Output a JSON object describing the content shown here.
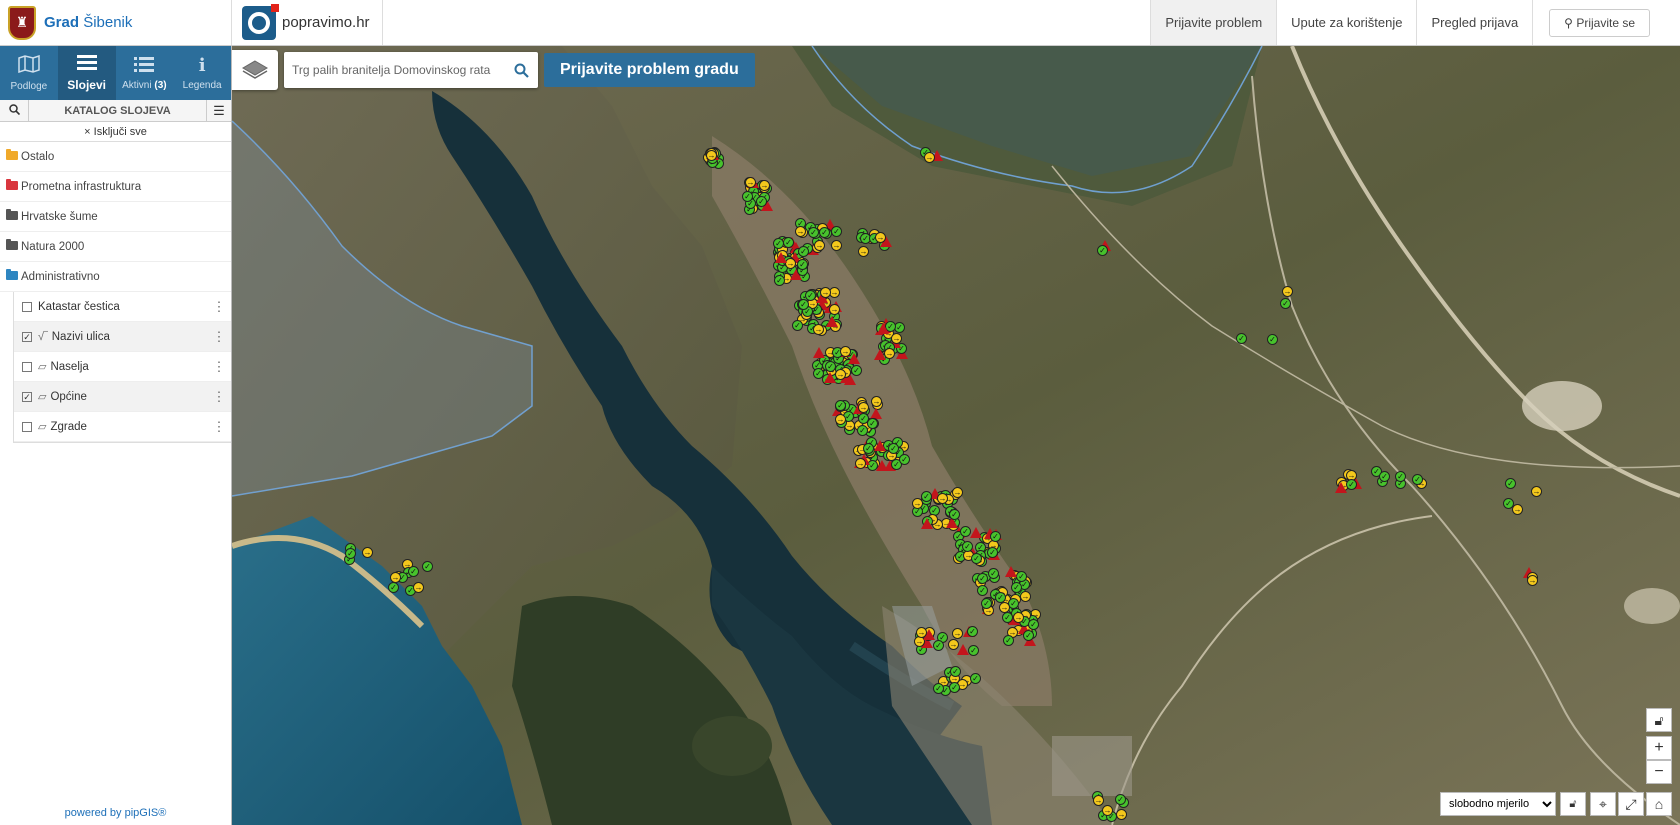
{
  "header": {
    "brand_bold": "Grad",
    "brand_rest": "Šibenik",
    "app_name": "popravimo.hr",
    "nav": [
      {
        "label": "Prijavite problem",
        "active": true
      },
      {
        "label": "Upute za korištenje",
        "active": false
      },
      {
        "label": "Pregled prijava",
        "active": false
      }
    ],
    "login_label": "Prijavite se"
  },
  "sidebar": {
    "tabs": [
      {
        "label": "Podloge",
        "icon": "map-icon"
      },
      {
        "label": "Slojevi",
        "icon": "layers-list-icon",
        "active": true
      },
      {
        "label": "Aktivni",
        "count": "(3)",
        "icon": "list-icon"
      },
      {
        "label": "Legenda",
        "icon": "info-icon"
      }
    ],
    "catalog_title": "KATALOG SLOJEVA",
    "disable_all": "Isključi sve",
    "groups": [
      {
        "label": "Ostalo",
        "color": "#f0a92a"
      },
      {
        "label": "Prometna infrastruktura",
        "color": "#d9363e"
      },
      {
        "label": "Hrvatske šume",
        "color": "#555555"
      },
      {
        "label": "Natura 2000",
        "color": "#555555"
      },
      {
        "label": "Administrativno",
        "color": "#2e86c1"
      }
    ],
    "layers": [
      {
        "label": "Katastar čestica",
        "checked": false,
        "symbol": ""
      },
      {
        "label": "Nazivi ulica",
        "checked": true,
        "symbol": "line"
      },
      {
        "label": "Naselja",
        "checked": false,
        "symbol": "polygon"
      },
      {
        "label": "Općine",
        "checked": true,
        "symbol": "polygon"
      },
      {
        "label": "Zgrade",
        "checked": false,
        "symbol": "polygon"
      }
    ],
    "powered_by": "powered by pipGIS®"
  },
  "map": {
    "search_placeholder": "Trg palih branitelja Domovinskog rata",
    "report_button": "Prijavite problem gradu",
    "scale_options": [
      "slobodno mjerilo"
    ],
    "controls": {
      "zoom_in": "+",
      "zoom_out": "−"
    }
  },
  "colors": {
    "accent": "#2c6e9b",
    "marker_resolved": "#47c22c",
    "marker_in_progress": "#f3c81c",
    "marker_reported": "#c3151c"
  }
}
